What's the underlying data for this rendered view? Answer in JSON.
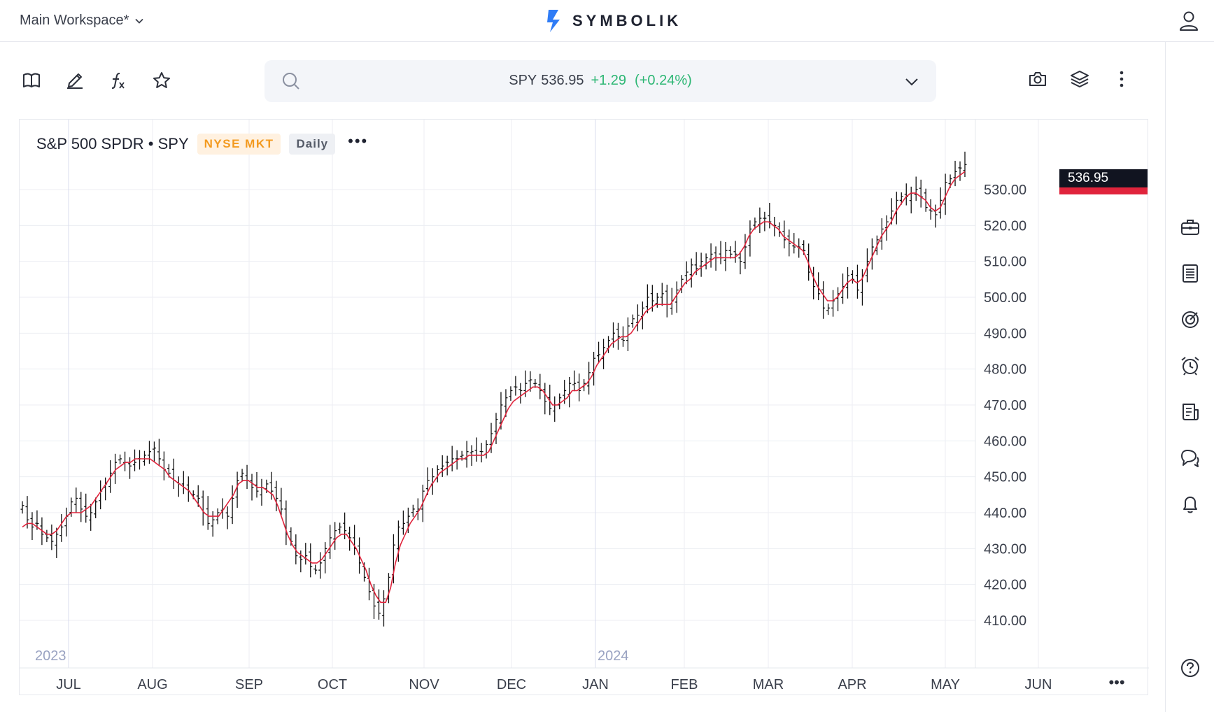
{
  "header": {
    "workspace_label": "Main Workspace*",
    "brand_name": "SYMBOLIK"
  },
  "toolbar": {
    "left_icons": [
      "book-icon",
      "pencil-icon",
      "function-icon",
      "star-icon"
    ],
    "right_icons": [
      "camera-icon",
      "layers-icon",
      "more-vertical-icon"
    ]
  },
  "search": {
    "symbol": "SPY",
    "price": "536.95",
    "change": "+1.29",
    "change_pct": "(+0.24%)"
  },
  "chart": {
    "title": "S&P 500 SPDR • SPY",
    "exchange": "NYSE MKT",
    "interval": "Daily",
    "last_price_tag": "536.95",
    "more_label": "•••"
  },
  "sidebar_icons": [
    "briefcase-icon",
    "watchlist-icon",
    "scanner-icon",
    "alarm-icon",
    "news-icon",
    "chat-icon",
    "bell-icon",
    "help-icon"
  ],
  "colors": {
    "accent_green": "#2bb673",
    "moving_average": "#e0243c",
    "exchange_badge": "#f39a1f",
    "brand_blue": "#2f7cf6"
  },
  "chart_data": {
    "type": "ohlc-bar",
    "title": "S&P 500 SPDR • SPY",
    "y_ticks": [
      "530.00",
      "520.00",
      "510.00",
      "500.00",
      "490.00",
      "480.00",
      "470.00",
      "460.00",
      "450.00",
      "440.00",
      "430.00",
      "420.00",
      "410.00"
    ],
    "ylim": [
      405,
      537
    ],
    "x_months": [
      "JUL",
      "AUG",
      "SEP",
      "OCT",
      "NOV",
      "DEC",
      "JAN",
      "FEB",
      "MAR",
      "APR",
      "MAY",
      "JUN"
    ],
    "year_labels": [
      "2023",
      "2024"
    ],
    "series": [
      {
        "kind": "price",
        "values": [
          442,
          438,
          436,
          437,
          434,
          433,
          432,
          434,
          436,
          439,
          443,
          444,
          441,
          439,
          440,
          443,
          446,
          448,
          451,
          454,
          455,
          454,
          453,
          454,
          455,
          456,
          457,
          458,
          455,
          452,
          451,
          449,
          448,
          447,
          446,
          445,
          444,
          440,
          437,
          438,
          440,
          441,
          439,
          444,
          449,
          451,
          449,
          447,
          446,
          447,
          448,
          446,
          444,
          441,
          434,
          432,
          428,
          427,
          428,
          425,
          424,
          426,
          430,
          433,
          435,
          436,
          435,
          433,
          430,
          426,
          422,
          418,
          414,
          412,
          416,
          422,
          431,
          436,
          437,
          439,
          441,
          441,
          446,
          449,
          450,
          452,
          453,
          454,
          455,
          455,
          456,
          457,
          457,
          456,
          457,
          459,
          462,
          466,
          470,
          472,
          474,
          475,
          474,
          476,
          477,
          476,
          474,
          471,
          469,
          470,
          472,
          474,
          476,
          476,
          474,
          476,
          479,
          483,
          484,
          486,
          488,
          490,
          489,
          488,
          492,
          494,
          495,
          497,
          500,
          499,
          500,
          501,
          498,
          499,
          502,
          505,
          507,
          509,
          508,
          510,
          511,
          512,
          511,
          511,
          513,
          512,
          512,
          510,
          514,
          519,
          521,
          522,
          522,
          521,
          520,
          518,
          516,
          515,
          514,
          514,
          513,
          507,
          503,
          501,
          497,
          497,
          499,
          501,
          503,
          506,
          505,
          502,
          506,
          510,
          514,
          516,
          519,
          521,
          524,
          527,
          528,
          528,
          529,
          530,
          528,
          525,
          524,
          523,
          527,
          532,
          533,
          535,
          536,
          536.95
        ],
        "open_approx_note_excluded": true
      },
      {
        "kind": "moving-average",
        "name": "",
        "values": [
          436,
          437,
          437,
          436,
          435,
          434,
          434,
          435,
          437,
          439,
          440,
          440,
          440,
          441,
          442,
          444,
          446,
          448,
          450,
          452,
          453,
          454,
          454,
          455,
          455,
          455,
          455,
          454,
          453,
          452,
          450,
          449,
          448,
          447,
          446,
          444,
          442,
          440,
          439,
          439,
          439,
          441,
          443,
          445,
          448,
          449,
          449,
          448,
          447,
          447,
          446,
          445,
          442,
          438,
          434,
          431,
          429,
          428,
          427,
          426,
          426,
          427,
          429,
          431,
          433,
          434,
          434,
          432,
          430,
          427,
          424,
          420,
          417,
          415,
          415,
          419,
          426,
          431,
          434,
          437,
          439,
          441,
          444,
          447,
          449,
          451,
          452,
          453,
          454,
          455,
          455,
          456,
          456,
          456,
          456,
          457,
          460,
          463,
          466,
          469,
          471,
          472,
          473,
          474,
          475,
          475,
          474,
          472,
          470,
          470,
          471,
          472,
          474,
          474,
          475,
          476,
          478,
          481,
          483,
          485,
          487,
          488,
          489,
          489,
          490,
          492,
          494,
          496,
          497,
          498,
          498,
          498,
          498,
          500,
          502,
          504,
          505,
          507,
          508,
          509,
          510,
          511,
          511,
          511,
          511,
          511,
          512,
          514,
          517,
          519,
          520,
          521,
          521,
          520,
          519,
          517,
          516,
          515,
          514,
          513,
          510,
          506,
          503,
          501,
          499,
          499,
          500,
          502,
          504,
          505,
          504,
          505,
          508,
          511,
          514,
          517,
          519,
          521,
          524,
          526,
          528,
          529,
          529,
          528,
          527,
          525,
          524,
          525,
          528,
          531,
          533,
          534,
          535
        ]
      }
    ],
    "grid": true
  }
}
